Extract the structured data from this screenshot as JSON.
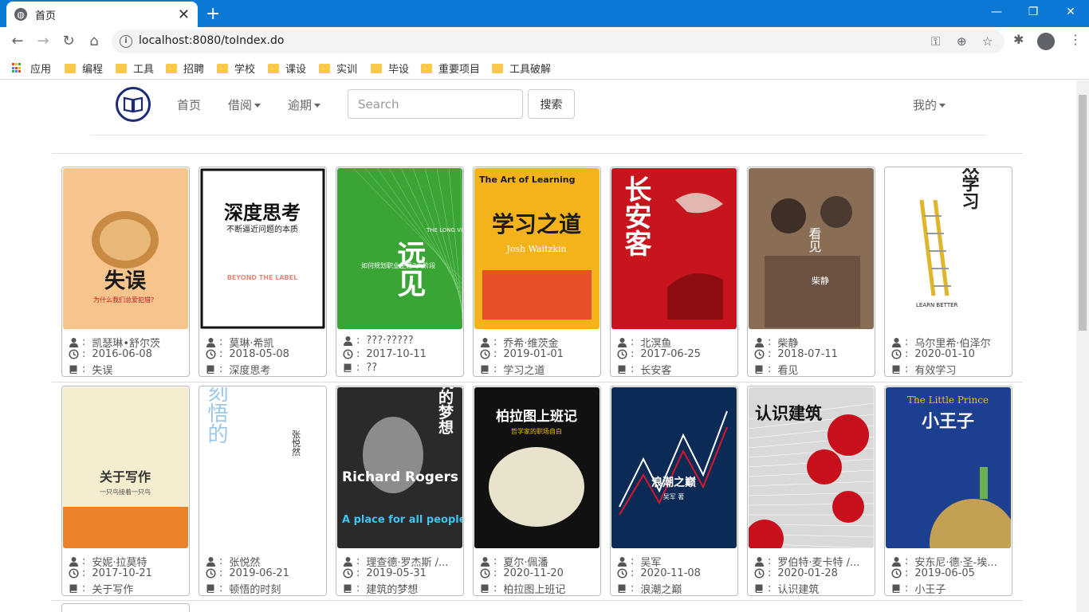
{
  "browser": {
    "tab_title": "首页",
    "tab_favicon": "globe-icon",
    "url": "localhost:8080/toIndex.do",
    "bookmarks": [
      {
        "label": "应用",
        "icon": "apps-grid-icon"
      },
      {
        "label": "编程",
        "icon": "folder-icon"
      },
      {
        "label": "工具",
        "icon": "folder-icon"
      },
      {
        "label": "招聘",
        "icon": "folder-icon"
      },
      {
        "label": "学校",
        "icon": "folder-icon"
      },
      {
        "label": "课设",
        "icon": "folder-icon"
      },
      {
        "label": "实训",
        "icon": "folder-icon"
      },
      {
        "label": "毕设",
        "icon": "folder-icon"
      },
      {
        "label": "重要项目",
        "icon": "folder-icon"
      },
      {
        "label": "工具破解",
        "icon": "folder-icon"
      }
    ]
  },
  "navbar": {
    "logo": "book-logo-icon",
    "home": "首页",
    "borrow": "借阅",
    "overdue": "逾期",
    "search_placeholder": "Search",
    "search_button": "搜索",
    "mine": "我的"
  },
  "colors": {
    "accent": "#1e2a78",
    "chrome": "#0b78d6",
    "folder": "#f9c749"
  },
  "books": [
    {
      "author": "凯瑟琳•舒尔茨",
      "date": "2016-06-08",
      "title": "失误",
      "cover_bg": "#f7c48d"
    },
    {
      "author": "莫琳·希凯",
      "date": "2018-05-08",
      "title": "深度思考",
      "cover_bg": "#ffffff"
    },
    {
      "author": "???·?????",
      "date": "2017-10-11",
      "title": "??",
      "cover_bg": "#3aa535"
    },
    {
      "author": "乔希·维茨金",
      "date": "2019-01-01",
      "title": "学习之道",
      "cover_bg": "#f4b21b"
    },
    {
      "author": "北溟鱼",
      "date": "2017-06-25",
      "title": "长安客",
      "cover_bg": "#c8141c"
    },
    {
      "author": "柴静",
      "date": "2018-07-11",
      "title": "看见",
      "cover_bg": "#8a6d55"
    },
    {
      "author": "乌尔里希·伯泽尔",
      "date": "2020-01-10",
      "title": "有效学习",
      "cover_bg": "#ffffff"
    },
    {
      "author": "安妮·拉莫特",
      "date": "2017-10-21",
      "title": "关于写作",
      "cover_bg": "#f6ecd0"
    },
    {
      "author": "张悦然",
      "date": "2019-06-21",
      "title": "顿悟的时刻",
      "cover_bg": "#ffffff"
    },
    {
      "author": "理查德·罗杰斯 /...",
      "date": "2019-05-31",
      "title": "建筑的梦想",
      "cover_bg": "#2a2a2a"
    },
    {
      "author": "夏尔·佩潘",
      "date": "2020-11-20",
      "title": "柏拉图上班记",
      "cover_bg": "#111111"
    },
    {
      "author": "吴军",
      "date": "2020-11-08",
      "title": "浪潮之巅",
      "cover_bg": "#0b2a55"
    },
    {
      "author": "罗伯特·麦卡特 /...",
      "date": "2020-01-28",
      "title": "认识建筑",
      "cover_bg": "#d9d9d9"
    },
    {
      "author": "安东尼·德·圣-埃...",
      "date": "2019-06-05",
      "title": "小王子",
      "cover_bg": "#1d3f8f"
    }
  ],
  "cover_text": {
    "b0_main": "失误",
    "b0_sub": "为什么我们总爱犯错？",
    "b1_main": "深度思考",
    "b1_sub": "不断逼近问题的本质",
    "b1_en": "BEYOND THE LABEL",
    "b2_main": "远见",
    "b2_en": "THE LONG VIEW",
    "b2_sub": "如何规划职业生涯3大阶段",
    "b3_en": "The Art of Learning",
    "b3_main": "学习之道",
    "b3_author": "Josh Waitzkin",
    "b4_main": "长安客",
    "b5_main": "看见",
    "b5_author": "柴静",
    "b6_main": "有效学习",
    "b6_en": "LEARN BETTER",
    "b7_main": "关于写作",
    "b7_sub": "一只鸟接着一只鸟",
    "b8_chars": "时顿刻悟的",
    "b8_author": "张悦然",
    "b9_main": "建筑的梦想",
    "b9_en": "Richard Rogers",
    "b9_en2": "A place for all people",
    "b10_main": "柏拉图上班记",
    "b10_sub": "哲学家的职场自白",
    "b11_main": "浪潮之巅",
    "b11_author": "吴军 著",
    "b12_main": "认识建筑",
    "b13_en": "The Little Prince",
    "b13_main": "小王子"
  }
}
